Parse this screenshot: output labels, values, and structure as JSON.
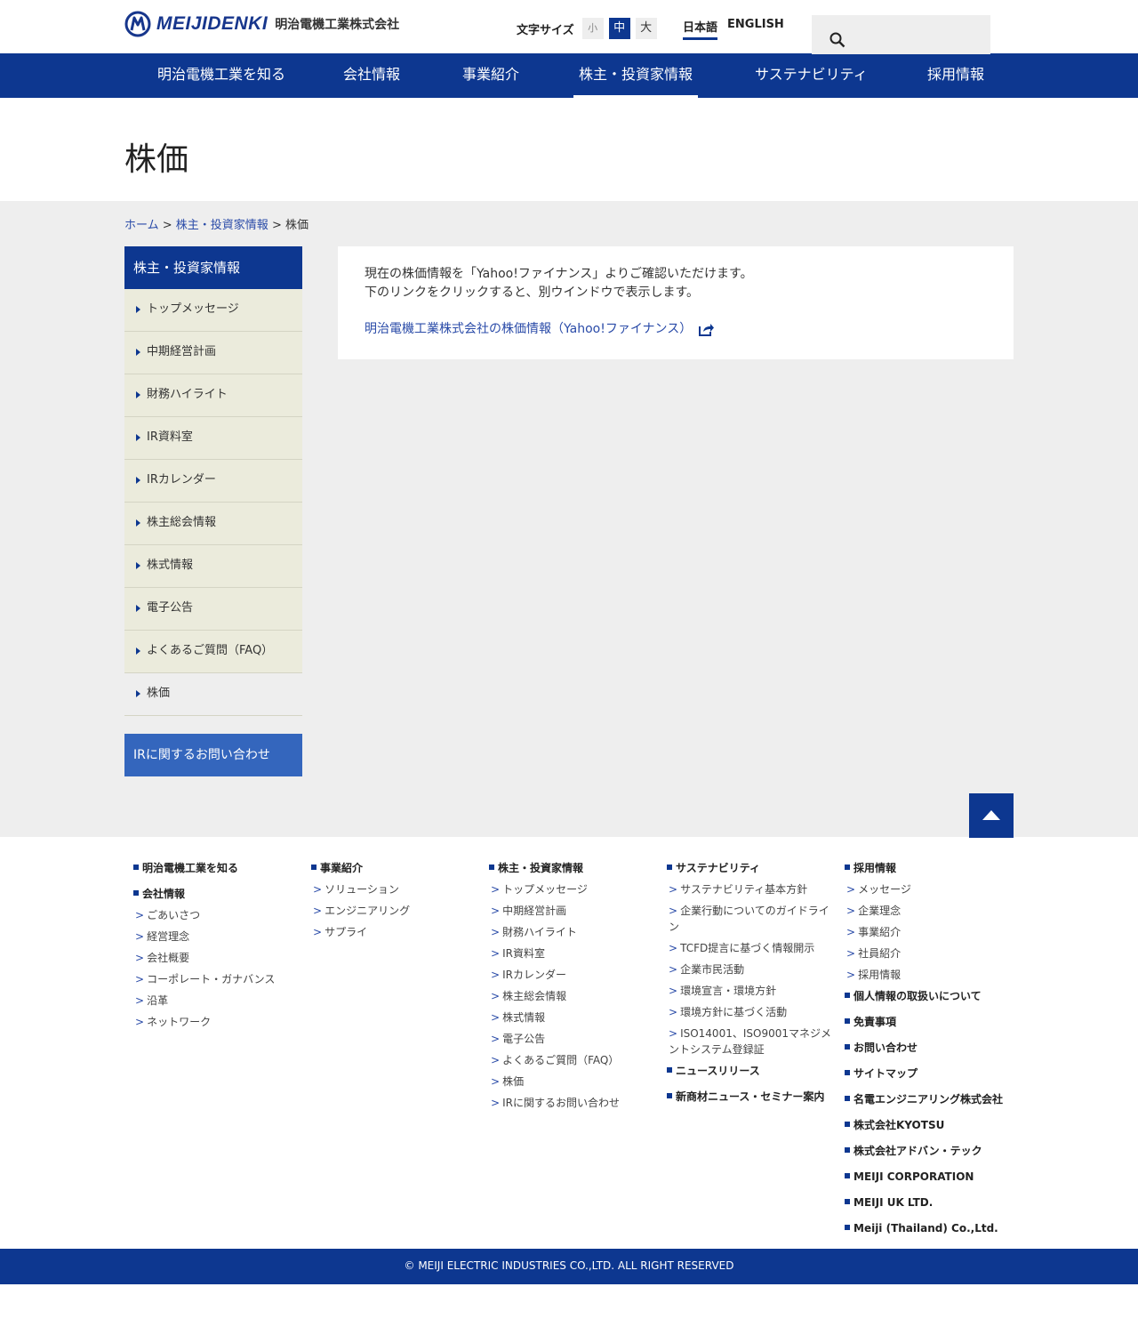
{
  "header": {
    "logo_text": "MEIJIDENKI",
    "logo_sub": "明治電機工業株式会社",
    "fontsize_label": "文字サイズ",
    "fontsize_small": "小",
    "fontsize_medium": "中",
    "fontsize_large": "大",
    "lang_ja": "日本語",
    "lang_en": "ENGLISH",
    "search_placeholder": ""
  },
  "gnav": [
    "明治電機工業を知る",
    "会社情報",
    "事業紹介",
    "株主・投資家情報",
    "サステナビリティ",
    "採用情報"
  ],
  "page_title": "株価",
  "breadcrumb": {
    "home": "ホーム",
    "sep1": " > ",
    "parent": "株主・投資家情報",
    "sep2": " > ",
    "current": "株価"
  },
  "sidebar": {
    "head": "株主・投資家情報",
    "items": [
      "トップメッセージ",
      "中期経営計画",
      "財務ハイライト",
      "IR資料室",
      "IRカレンダー",
      "株主総会情報",
      "株式情報",
      "電子公告",
      "よくあるご質問（FAQ）",
      "株価"
    ],
    "contact": "IRに関するお問い合わせ"
  },
  "content": {
    "line1": "現在の株価情報を「Yahoo!ファイナンス」よりご確認いただけます。",
    "line2": "下のリンクをクリックすると、別ウインドウで表示します。",
    "link": "明治電機工業株式会社の株価情報（Yahoo!ファイナンス）"
  },
  "footer": {
    "col1": {
      "head1": "明治電機工業を知る",
      "head2": "会社情報",
      "items": [
        "ごあいさつ",
        "経営理念",
        "会社概要",
        "コーポレート・ガナバンス",
        "沿革",
        "ネットワーク"
      ]
    },
    "col2": {
      "head": "事業紹介",
      "items": [
        "ソリューション",
        "エンジニアリング",
        "サプライ"
      ]
    },
    "col3": {
      "head": "株主・投資家情報",
      "items": [
        "トップメッセージ",
        "中期経営計画",
        "財務ハイライト",
        "IR資料室",
        "IRカレンダー",
        "株主総会情報",
        "株式情報",
        "電子公告",
        "よくあるご質問（FAQ）",
        "株価",
        "IRに関するお問い合わせ"
      ]
    },
    "col4": {
      "head": "サステナビリティ",
      "items": [
        "サステナビリティ基本方針",
        "企業行動についてのガイドライン",
        "TCFD提言に基づく情報開示",
        "企業市民活動",
        "環境宣言・環境方針",
        "環境方針に基づく活動",
        "ISO14001、ISO9001マネジメントシステム登録証"
      ],
      "head2": "ニュースリリース",
      "head3": "新商材ニュース・セミナー案内"
    },
    "col5": {
      "head": "採用情報",
      "items": [
        "メッセージ",
        "企業理念",
        "事業紹介",
        "社員紹介",
        "採用情報"
      ],
      "links": [
        "個人情報の取扱いについて",
        "免責事項",
        "お問い合わせ",
        "サイトマップ",
        "名電エンジニアリング株式会社",
        "株式会社KYOTSU",
        "株式会社アドバン・テック",
        "MEIJI CORPORATION",
        "MEIJI UK LTD.",
        "Meiji (Thailand) Co.,Ltd."
      ]
    },
    "copyright": "© MEIJI ELECTRIC INDUSTRIES CO.,LTD. ALL RIGHT RESERVED"
  },
  "colors": {
    "brand_navy": "#0d3790",
    "link_blue": "#2a4ba8",
    "sidebar_bg": "#ebebdc",
    "contact_blue": "#3466bd",
    "main_bg": "#eeeeee"
  }
}
